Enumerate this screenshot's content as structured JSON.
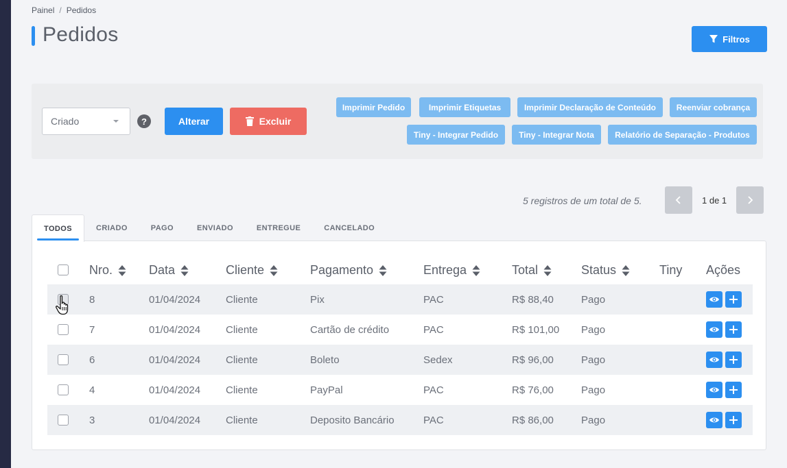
{
  "breadcrumb": {
    "root": "Painel",
    "current": "Pedidos"
  },
  "page": {
    "title": "Pedidos"
  },
  "toolbar": {
    "filter_label": "Filtros"
  },
  "bulk": {
    "status_selected": "Criado",
    "help_icon": "?",
    "alterar_label": "Alterar",
    "excluir_label": "Excluir",
    "actions": [
      "Imprimir Pedido",
      "Imprimir Etiquetas",
      "Imprimir Declaração de Conteúdo",
      "Reenviar cobrança",
      "Tiny - Integrar Pedido",
      "Tiny - Integrar Nota",
      "Relatório de Separação - Produtos"
    ]
  },
  "pagination": {
    "info": "5 registros de um total de 5.",
    "page_text": "1 de 1"
  },
  "tabs": [
    "TODOS",
    "CRIADO",
    "PAGO",
    "ENVIADO",
    "ENTREGUE",
    "CANCELADO"
  ],
  "table": {
    "headers": [
      "Nro.",
      "Data",
      "Cliente",
      "Pagamento",
      "Entrega",
      "Total",
      "Status",
      "Tiny",
      "Ações"
    ],
    "rows": [
      [
        "8",
        "01/04/2024",
        "Cliente",
        "Pix",
        "PAC",
        "R$ 88,40",
        "Pago"
      ],
      [
        "7",
        "01/04/2024",
        "Cliente",
        "Cartão de crédito",
        "PAC",
        "R$ 101,00",
        "Pago"
      ],
      [
        "6",
        "01/04/2024",
        "Cliente",
        "Boleto",
        "Sedex",
        "R$ 96,00",
        "Pago"
      ],
      [
        "4",
        "01/04/2024",
        "Cliente",
        "PayPal",
        "PAC",
        "R$ 76,00",
        "Pago"
      ],
      [
        "3",
        "01/04/2024",
        "Cliente",
        "Deposito Bancário",
        "PAC",
        "R$ 86,00",
        "Pago"
      ]
    ]
  },
  "icons": {
    "filter": "filter-icon",
    "trash": "trash-icon",
    "chevron_left": "chevron-left-icon",
    "chevron_right": "chevron-right-icon",
    "sort": "sort-icon",
    "view": "eye-icon",
    "add": "plus-icon",
    "cursor": "hand-pointer-icon"
  },
  "colors": {
    "primary": "#2c8ff0",
    "danger": "#ee6b62",
    "light_primary": "#7cbbf1",
    "sidebar": "#262a44"
  }
}
